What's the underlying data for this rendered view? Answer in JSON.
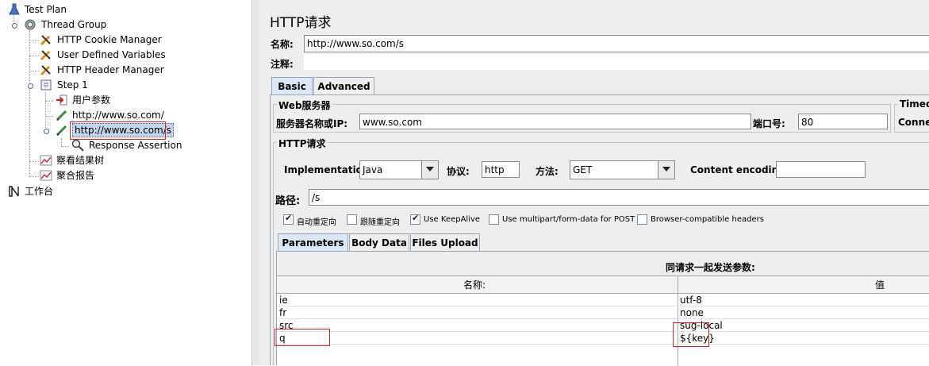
{
  "tree": {
    "items": [
      {
        "label": "Test Plan",
        "icon": "test-plan-icon"
      },
      {
        "label": "Thread Group",
        "icon": "gear-icon"
      },
      {
        "label": "HTTP Cookie Manager",
        "icon": "wrench-icon"
      },
      {
        "label": "User Defined Variables",
        "icon": "wrench-icon"
      },
      {
        "label": "HTTP Header Manager",
        "icon": "wrench-icon"
      },
      {
        "label": "Step 1",
        "icon": "controller-icon"
      },
      {
        "label": "用户参数",
        "icon": "arrow-in-icon"
      },
      {
        "label": "http://www.so.com/",
        "icon": "pen-icon"
      },
      {
        "label": "http://www.so.com/s",
        "icon": "pen-icon"
      },
      {
        "label": "Response Assertion",
        "icon": "magnifier-icon"
      },
      {
        "label": "察看结果树",
        "icon": "graph-icon"
      },
      {
        "label": "聚合报告",
        "icon": "graph-icon"
      },
      {
        "label": "工作台",
        "icon": "workbench-icon"
      }
    ]
  },
  "panel": {
    "title": "HTTP请求",
    "name_label": "名称:",
    "name_value": "http://www.so.com/s",
    "comment_label": "注释:",
    "tabs": [
      "Basic",
      "Advanced"
    ],
    "web_server": {
      "legend": "Web服务器",
      "host_label": "服务器名称或IP:",
      "host_value": "www.so.com",
      "port_label": "端口号:",
      "port_value": "80",
      "timeout_legend": "Timeo",
      "connect_label": "Connec"
    },
    "http_request": {
      "legend": "HTTP请求",
      "impl_label": "Implementation:",
      "impl_value": "Java",
      "protocol_label": "协议:",
      "protocol_value": "http",
      "method_label": "方法:",
      "method_value": "GET",
      "encoding_label": "Content encoding:",
      "encoding_value": "",
      "path_label": "路径:",
      "path_value": "/s"
    },
    "checkboxes": [
      {
        "label": "自动重定向",
        "checked": true
      },
      {
        "label": "跟随重定向",
        "checked": false
      },
      {
        "label": "Use KeepAlive",
        "checked": true
      },
      {
        "label": "Use multipart/form-data for POST",
        "checked": false
      },
      {
        "label": "Browser-compatible headers",
        "checked": false
      }
    ],
    "subtabs": [
      "Parameters",
      "Body Data",
      "Files Upload"
    ],
    "params_caption": "同请求一起发送参数:",
    "table": {
      "headers": [
        "名称:",
        "值"
      ],
      "rows": [
        [
          "ie",
          "utf-8"
        ],
        [
          "fr",
          "none"
        ],
        [
          "src",
          "sug-local"
        ],
        [
          "q",
          "${key}"
        ]
      ]
    }
  },
  "colors": {
    "selection": "#c3d5ec",
    "highlight": "#e02020"
  }
}
